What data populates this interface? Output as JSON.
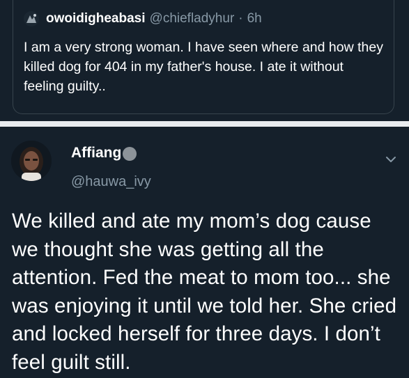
{
  "quoted_tweet": {
    "display_name": "owoidigheabasi",
    "handle": "@chiefladyhur",
    "separator": "·",
    "time": "6h",
    "text": "I am a very strong woman. I have seen where and how they killed dog for 404 in my father's house. I ate it without feeling guilty.."
  },
  "tweet": {
    "display_name": "Affiang",
    "handle": "@hauwa_ivy",
    "text": "We killed and ate my mom’s dog cause we thought she was getting all the attention. Fed the meat to mom too... she was enjoying it until we told her. She cried and locked herself for three days. I don’t feel guilt still."
  },
  "icons": {
    "quoted_avatar": "avatar-icon",
    "author_avatar": "avatar-photo",
    "badge": "circle-badge-icon",
    "menu": "chevron-down-icon"
  },
  "colors": {
    "background": "#15202b",
    "secondary_text": "#8899a6",
    "divider": "#e9ecef",
    "border": "#38444d"
  }
}
